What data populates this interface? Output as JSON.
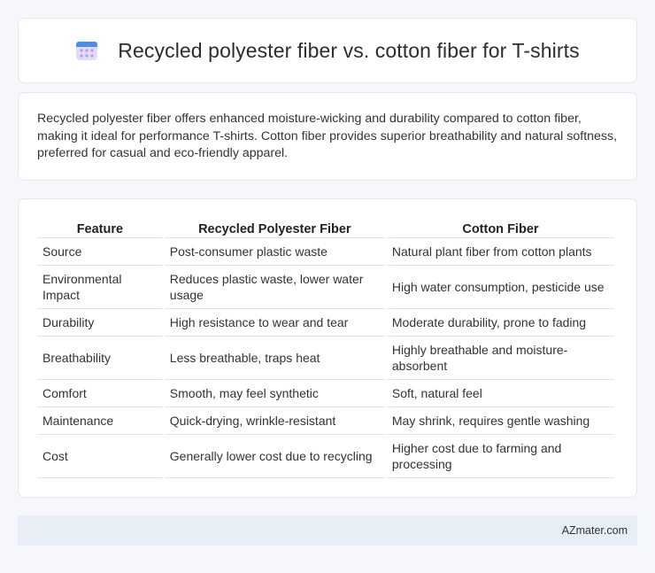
{
  "header": {
    "title": "Recycled polyester fiber vs. cotton fiber for T-shirts",
    "icon": "calendar-icon"
  },
  "summary": {
    "text": "Recycled polyester fiber offers enhanced moisture-wicking and durability compared to cotton fiber, making it ideal for performance T-shirts. Cotton fiber provides superior breathability and natural softness, preferred for casual and eco-friendly apparel."
  },
  "table": {
    "headers": [
      "Feature",
      "Recycled Polyester Fiber",
      "Cotton Fiber"
    ],
    "rows": [
      [
        "Source",
        "Post-consumer plastic waste",
        "Natural plant fiber from cotton plants"
      ],
      [
        "Environmental Impact",
        "Reduces plastic waste, lower water usage",
        "High water consumption, pesticide use"
      ],
      [
        "Durability",
        "High resistance to wear and tear",
        "Moderate durability, prone to fading"
      ],
      [
        "Breathability",
        "Less breathable, traps heat",
        "Highly breathable and moisture-absorbent"
      ],
      [
        "Comfort",
        "Smooth, may feel synthetic",
        "Soft, natural feel"
      ],
      [
        "Maintenance",
        "Quick-drying, wrinkle-resistant",
        "May shrink, requires gentle washing"
      ],
      [
        "Cost",
        "Generally lower cost due to recycling",
        "Higher cost due to farming and processing"
      ]
    ]
  },
  "footer": {
    "brand": "AZmater.com"
  }
}
